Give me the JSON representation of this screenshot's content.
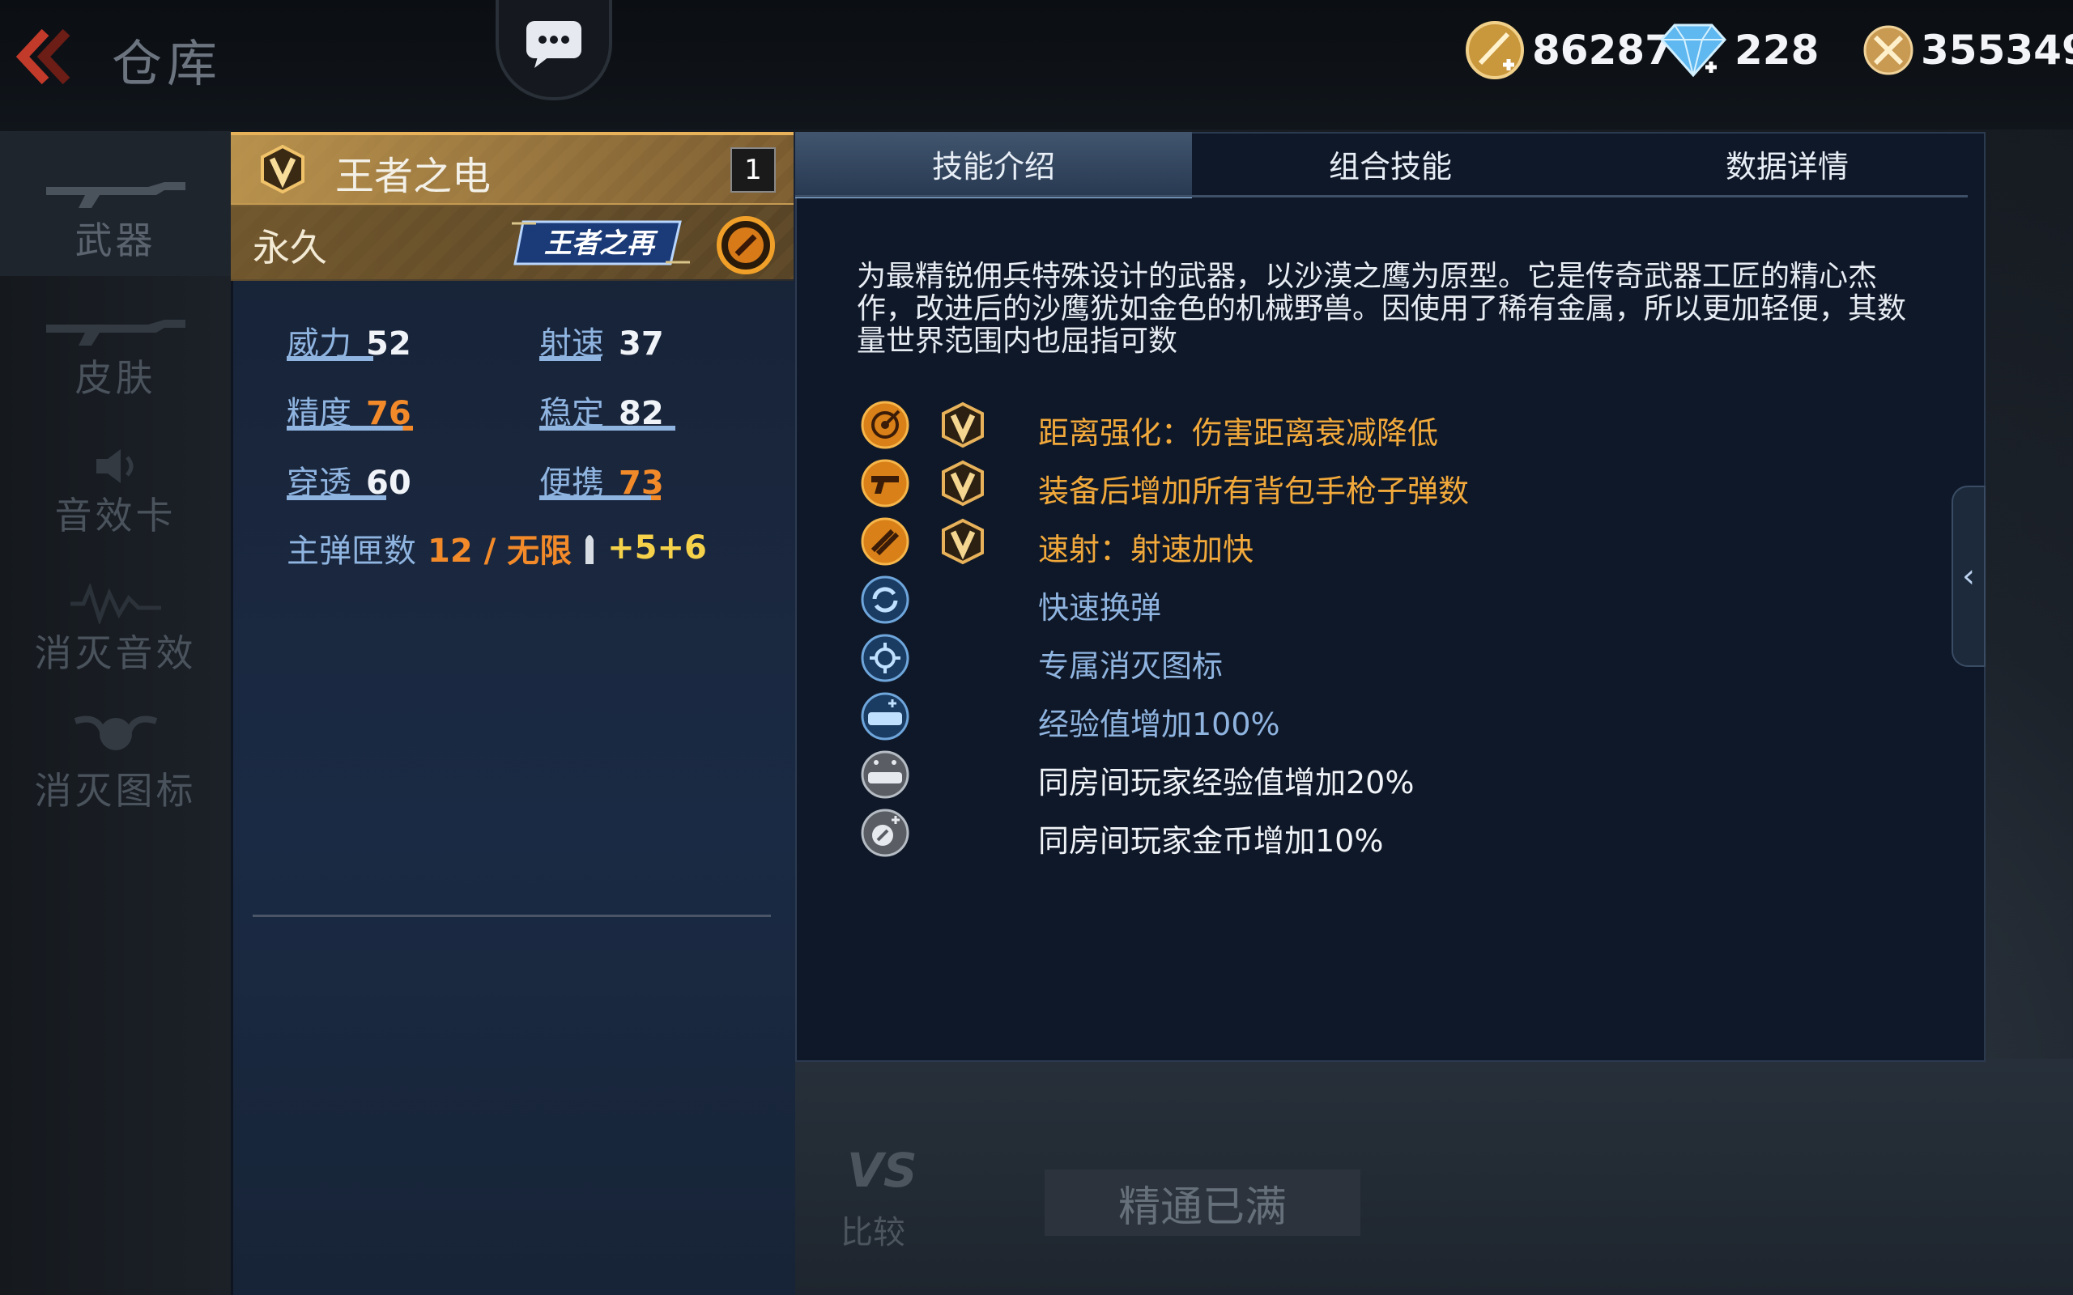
{
  "header": {
    "title": "仓库",
    "currencies": [
      {
        "icon": "gold-coin-icon",
        "value": "86287"
      },
      {
        "icon": "diamond-icon",
        "value": "228"
      },
      {
        "icon": "honor-coin-icon",
        "value": "355349"
      }
    ]
  },
  "sidebar": {
    "items": [
      {
        "label": "武器",
        "icon": "rifle-icon"
      },
      {
        "label": "皮肤",
        "icon": "rifle-skin-icon"
      },
      {
        "label": "音效卡",
        "icon": "speaker-icon"
      },
      {
        "label": "消灭音效",
        "icon": "sound-wave-icon"
      },
      {
        "label": "消灭图标",
        "icon": "skull-wings-icon"
      }
    ]
  },
  "weapon": {
    "name": "王者之电",
    "rank": "1",
    "duration": "永久",
    "brand_logo": "王者之再",
    "stats": [
      {
        "label": "威力",
        "value": "52",
        "level": 52,
        "color": "#f0f3f7"
      },
      {
        "label": "射速",
        "value": "37",
        "level": 37,
        "color": "#f0f3f7"
      },
      {
        "label": "精度",
        "value": "76",
        "level": 76,
        "color": "#f28a2a"
      },
      {
        "label": "稳定",
        "value": "82",
        "level": 82,
        "color": "#f0f3f7"
      },
      {
        "label": "穿透",
        "value": "60",
        "level": 60,
        "color": "#f0f3f7"
      },
      {
        "label": "便携",
        "value": "73",
        "level": 73,
        "color": "#f28a2a"
      }
    ],
    "ammo": {
      "label": "主弹匣数",
      "value": "12 / 无限",
      "bonus": "+5+6"
    }
  },
  "tabs": [
    {
      "label": "技能介绍",
      "active": true
    },
    {
      "label": "组合技能",
      "active": false
    },
    {
      "label": "数据详情",
      "active": false
    }
  ],
  "description": "为最精锐佣兵特殊设计的武器，以沙漠之鹰为原型。它是传奇武器工匠的精心杰作，改进后的沙鹰犹如金色的机械野兽。因使用了稀有金属，所以更加轻便，其数量世界范围内也屈指可数",
  "skills": [
    {
      "icon": "range-target-icon",
      "text": "距离强化：伤害距离衰减降低",
      "color": "#f2a93b",
      "v_badge": true
    },
    {
      "icon": "pistol-icon",
      "text": "装备后增加所有背包手枪子弹数",
      "color": "#f2a93b",
      "v_badge": true
    },
    {
      "icon": "rapid-fire-icon",
      "text": "速射：射速加快",
      "color": "#f2a93b",
      "v_badge": true
    },
    {
      "icon": "reload-icon",
      "text": "快速换弹",
      "color": "#8fb4e0",
      "v_badge": false
    },
    {
      "icon": "kill-icon-icon",
      "text": "专属消灭图标",
      "color": "#8fb4e0",
      "v_badge": false
    },
    {
      "icon": "exp-icon",
      "text": "经验值增加100%",
      "color": "#8fb4e0",
      "v_badge": false
    },
    {
      "icon": "room-exp-icon",
      "text": "同房间玩家经验值增加20%",
      "color": "#f0f3f7",
      "v_badge": false
    },
    {
      "icon": "room-coin-icon",
      "text": "同房间玩家金币增加10%",
      "color": "#f0f3f7",
      "v_badge": false
    }
  ],
  "bottom": {
    "compare_top": "VS",
    "compare_label": "比较",
    "mastery": "精通已满"
  },
  "colors": {
    "accent_gold": "#e8b25a",
    "accent_blue": "#8fb4e0",
    "highlight_orange": "#f28a2a"
  }
}
